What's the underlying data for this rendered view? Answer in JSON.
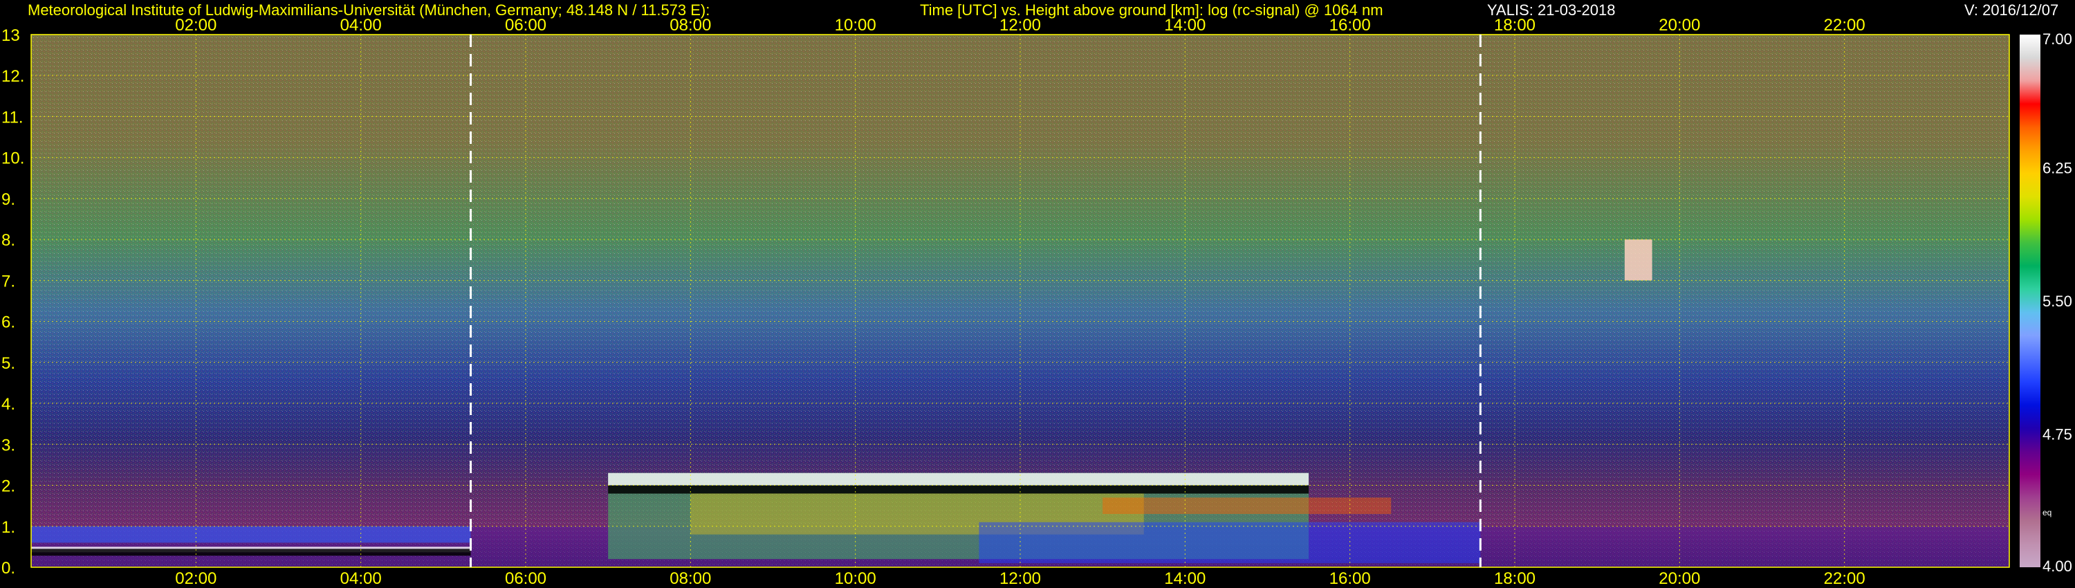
{
  "header": {
    "institute": "Meteorological Institute of Ludwig-Maximilians-Universität (München, Germany; 48.148 N / 11.573 E):",
    "title": "Time [UTC] vs. Height above ground [km]: log (rc-signal) @ 1064 nm",
    "station": "YALIS: 21-03-2018",
    "version": "V: 2016/12/07"
  },
  "chart_data": {
    "type": "heatmap",
    "title": "Time [UTC] vs. Height above ground [km]: log (rc-signal) @ 1064 nm",
    "xlabel": "Time [UTC]",
    "ylabel": "Height above ground [km]",
    "xlim": [
      "00:00",
      "24:00"
    ],
    "ylim": [
      0,
      13
    ],
    "x_ticks": [
      "02:00",
      "04:00",
      "06:00",
      "08:00",
      "10:00",
      "12:00",
      "14:00",
      "16:00",
      "18:00",
      "20:00",
      "22:00"
    ],
    "y_ticks": [
      "0.",
      "1.",
      "2.",
      "3.",
      "4.",
      "5.",
      "6.",
      "7.",
      "8.",
      "9.",
      "10.",
      "11.",
      "12.",
      "13"
    ],
    "grid": true,
    "colorbar": {
      "min": 4.0,
      "max": 7.0,
      "labels": [
        "7.00",
        "6.25",
        "5.50",
        "4.75",
        "4.00"
      ],
      "unit_note": "eq",
      "colors": [
        "#ffffff",
        "#d8d8d8",
        "#f0a0a0",
        "#ff0000",
        "#ff6000",
        "#ffa000",
        "#ffd000",
        "#e0e000",
        "#a0e000",
        "#40c040",
        "#00b060",
        "#30d0a0",
        "#60c0f0",
        "#80a0ff",
        "#5070ff",
        "#2040ff",
        "#0010e0",
        "#2000b0",
        "#600090",
        "#900080",
        "#a04090",
        "#b07090",
        "#c090b0",
        "#c8a8c8"
      ]
    },
    "markers": {
      "dashed_time_lines": [
        "05:20",
        "17:35"
      ]
    },
    "features": {
      "cloud_layer": {
        "time_start": "07:00",
        "time_end": "15:30",
        "height_km": [
          2.0,
          2.3
        ]
      },
      "residual_layer_top_km": 1.0,
      "high_cloud": {
        "time_start": "19:20",
        "time_end": "19:40",
        "height_km": [
          7.0,
          8.0
        ]
      }
    }
  }
}
